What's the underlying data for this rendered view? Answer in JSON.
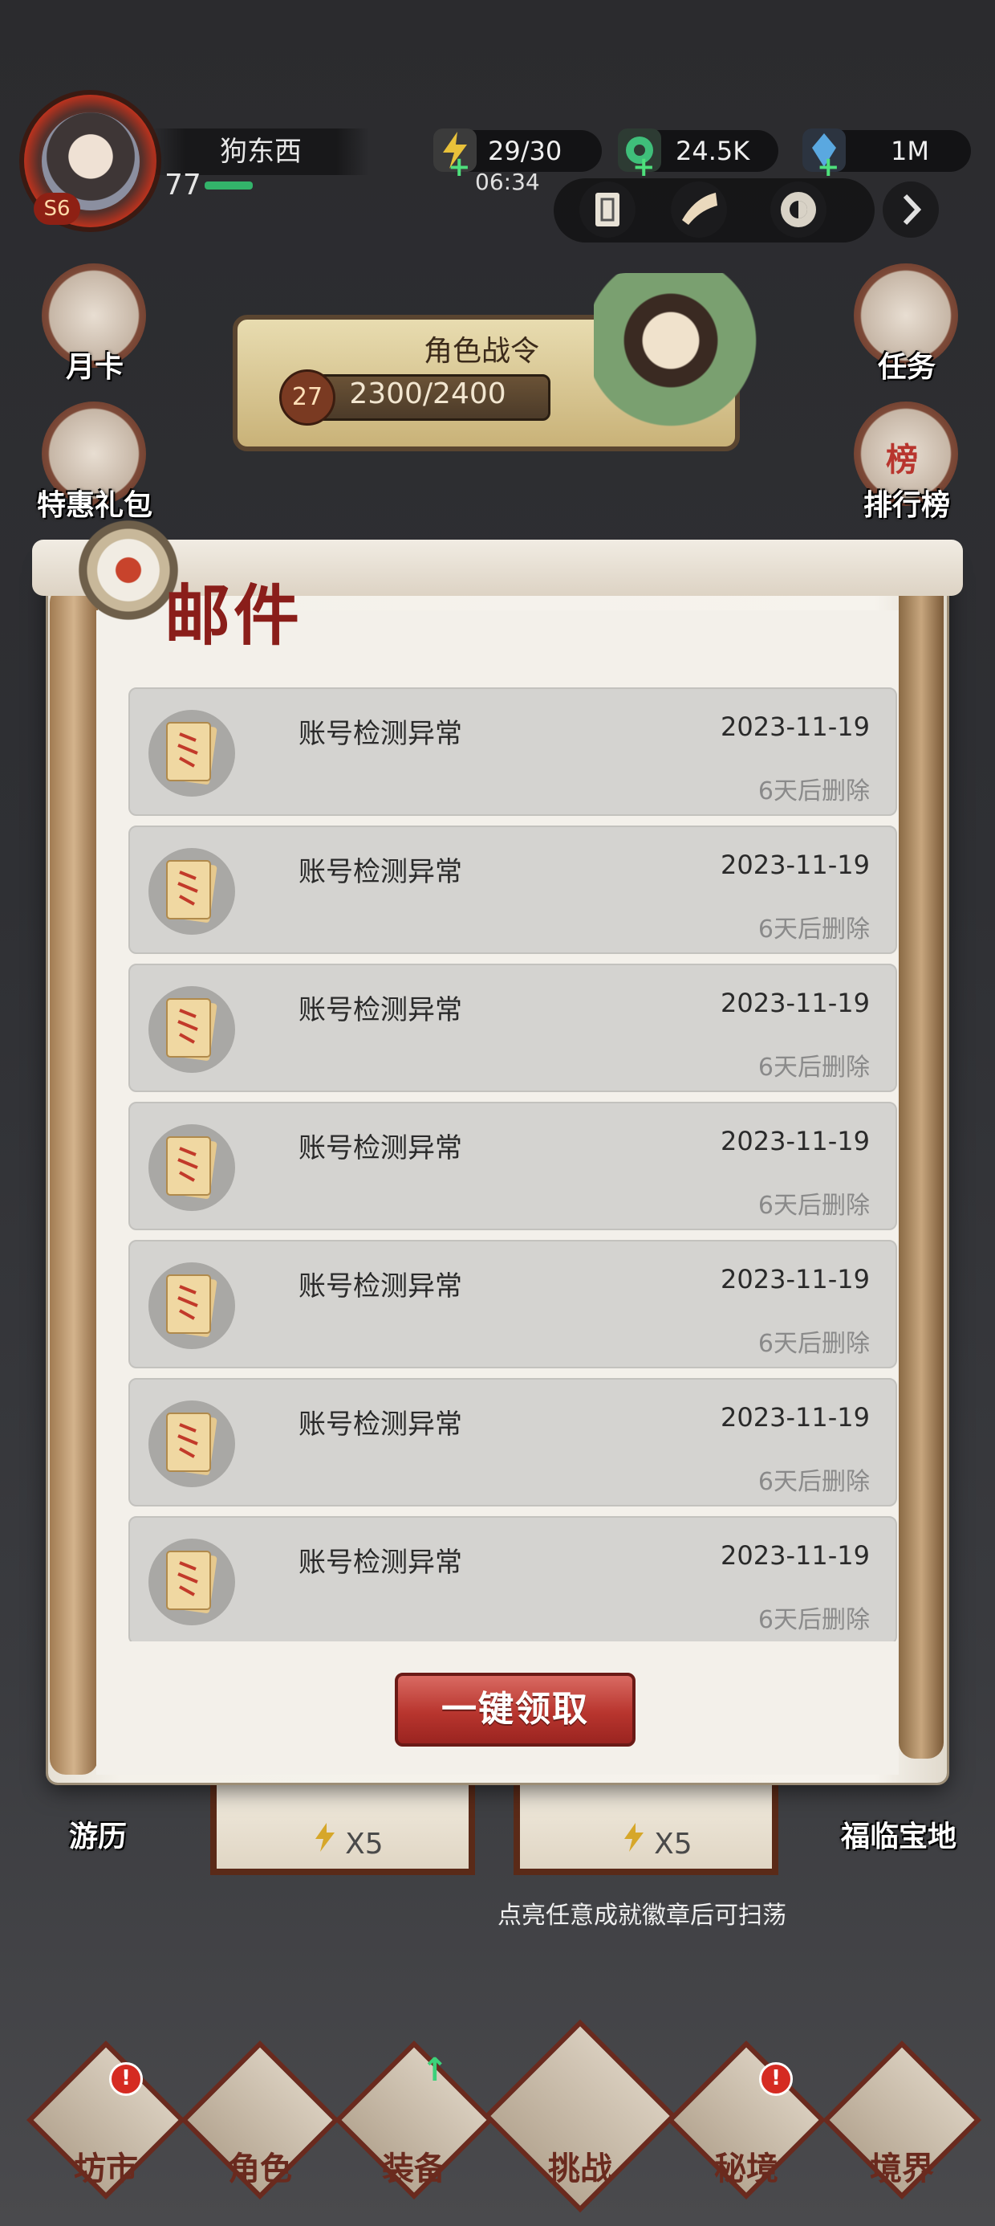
{
  "player": {
    "name": "狗东西",
    "level": "77",
    "server": "S6"
  },
  "resources": {
    "stamina": "29/30",
    "stamina_timer": "06:34",
    "jade": "24.5K",
    "crystal": "1M"
  },
  "side_left": {
    "monthly_card": "月卡",
    "special_gift": "特惠礼包",
    "travel": "游历"
  },
  "side_right": {
    "tasks": "任务",
    "ranking": "排行榜",
    "ranking_badge": "榜",
    "fortune": "福临宝地"
  },
  "battle_pass": {
    "title": "角色战令",
    "level": "27",
    "progress_text": "2300/2400"
  },
  "mail": {
    "title": "邮件",
    "claim_all_label": "一键领取",
    "items": [
      {
        "subject": "账号检测异常",
        "date": "2023-11-19",
        "expire": "6天后删除"
      },
      {
        "subject": "账号检测异常",
        "date": "2023-11-19",
        "expire": "6天后删除"
      },
      {
        "subject": "账号检测异常",
        "date": "2023-11-19",
        "expire": "6天后删除"
      },
      {
        "subject": "账号检测异常",
        "date": "2023-11-19",
        "expire": "6天后删除"
      },
      {
        "subject": "账号检测异常",
        "date": "2023-11-19",
        "expire": "6天后删除"
      },
      {
        "subject": "账号检测异常",
        "date": "2023-11-19",
        "expire": "6天后删除"
      },
      {
        "subject": "账号检测异常",
        "date": "2023-11-19",
        "expire": "6天后删除"
      }
    ]
  },
  "sweep": {
    "cost_left": "X5",
    "cost_right": "X5",
    "hint": "点亮任意成就徽章后可扫荡"
  },
  "bottom_nav": {
    "market": "坊市",
    "character": "角色",
    "equipment": "装备",
    "challenge": "挑战",
    "secret_realm": "秘境",
    "realm": "境界",
    "badge_mark": "!"
  },
  "colors": {
    "accent_red": "#b8352e",
    "title_red": "#8a1e1a",
    "paper": "#f3f0ea",
    "row_bg": "#d4d3d0"
  }
}
